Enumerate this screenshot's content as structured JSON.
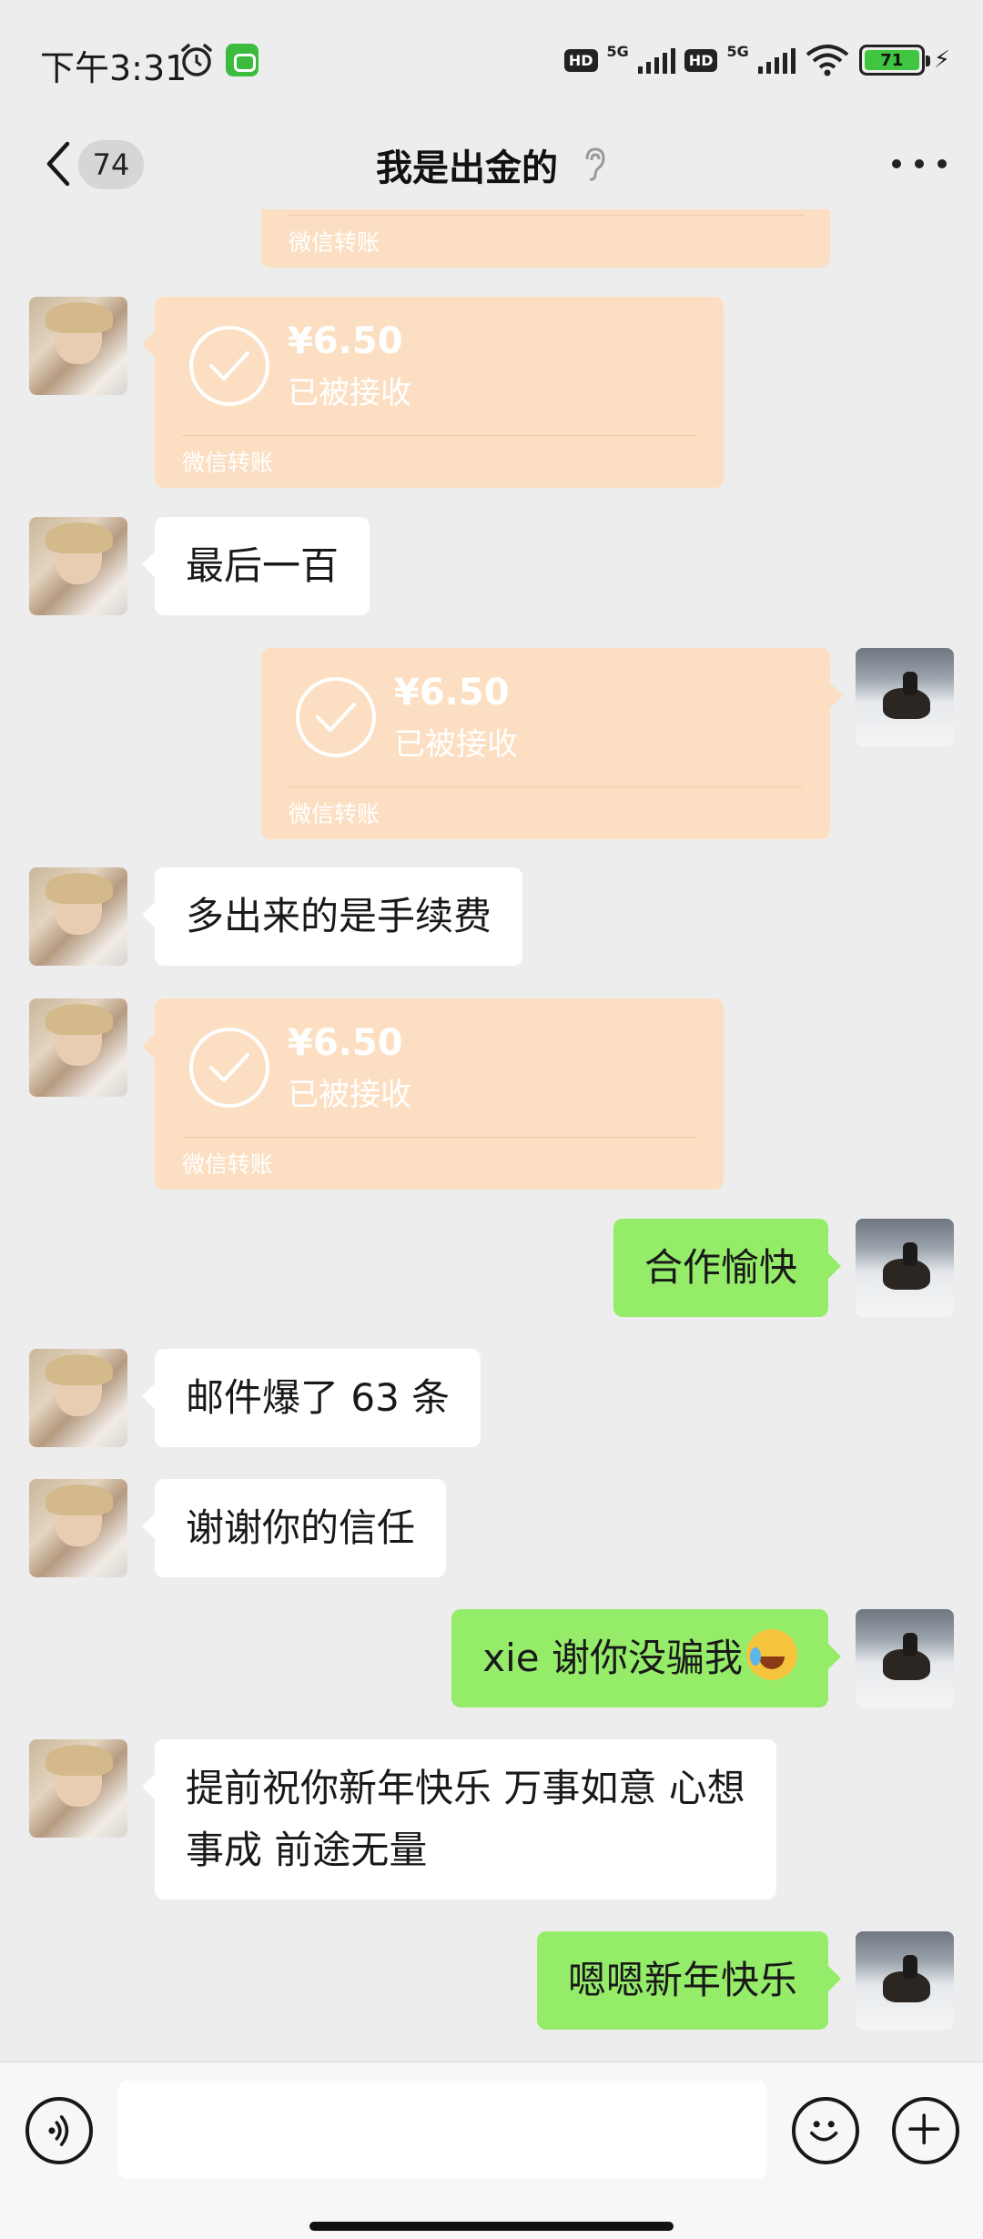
{
  "status_bar": {
    "time": "下午3:31",
    "network_badge_1": "HD",
    "network_gen_1": "5G",
    "network_badge_2": "HD",
    "network_gen_2": "5G",
    "battery_level": "71"
  },
  "header": {
    "unread_count": "74",
    "title": "我是出金的"
  },
  "messages": [
    {
      "kind": "transfer",
      "from": "peer",
      "amount": "",
      "status": "",
      "footer": "微信转账"
    },
    {
      "kind": "transfer",
      "from": "peer",
      "amount": "¥6.50",
      "status": "已被接收",
      "footer": "微信转账"
    },
    {
      "kind": "text",
      "from": "peer",
      "text": "最后一百"
    },
    {
      "kind": "transfer",
      "from": "self",
      "amount": "¥6.50",
      "status": "已被接收",
      "footer": "微信转账"
    },
    {
      "kind": "text",
      "from": "peer",
      "text": "多出来的是手续费"
    },
    {
      "kind": "transfer",
      "from": "peer",
      "amount": "¥6.50",
      "status": "已被接收",
      "footer": "微信转账"
    },
    {
      "kind": "text",
      "from": "self",
      "text": "合作愉快"
    },
    {
      "kind": "text",
      "from": "peer",
      "text": "邮件爆了 63 条"
    },
    {
      "kind": "text",
      "from": "peer",
      "text": "谢谢你的信任"
    },
    {
      "kind": "text",
      "from": "self",
      "text": "xie 谢你没骗我",
      "emoji": "laughing-crying-emoji"
    },
    {
      "kind": "text",
      "from": "peer",
      "text_line_1": "提前祝你新年快乐 万事如意 心想",
      "text_line_2": "事成 前途无量"
    },
    {
      "kind": "text",
      "from": "self",
      "text": "嗯嗯新年快乐"
    }
  ],
  "input": {
    "value": "",
    "placeholder": ""
  },
  "colors": {
    "background": "#ededed",
    "incoming_bubble": "#ffffff",
    "outgoing_bubble": "#95ec69",
    "transfer_card": "#fcdfc2",
    "battery_fill": "#3fc53f"
  },
  "icons": [
    "alarm-icon",
    "app-icon",
    "wifi-icon",
    "back-arrow-icon",
    "ear-icon",
    "more-icon",
    "check-circle-icon",
    "voice-icon",
    "emoji-icon",
    "plus-icon"
  ]
}
